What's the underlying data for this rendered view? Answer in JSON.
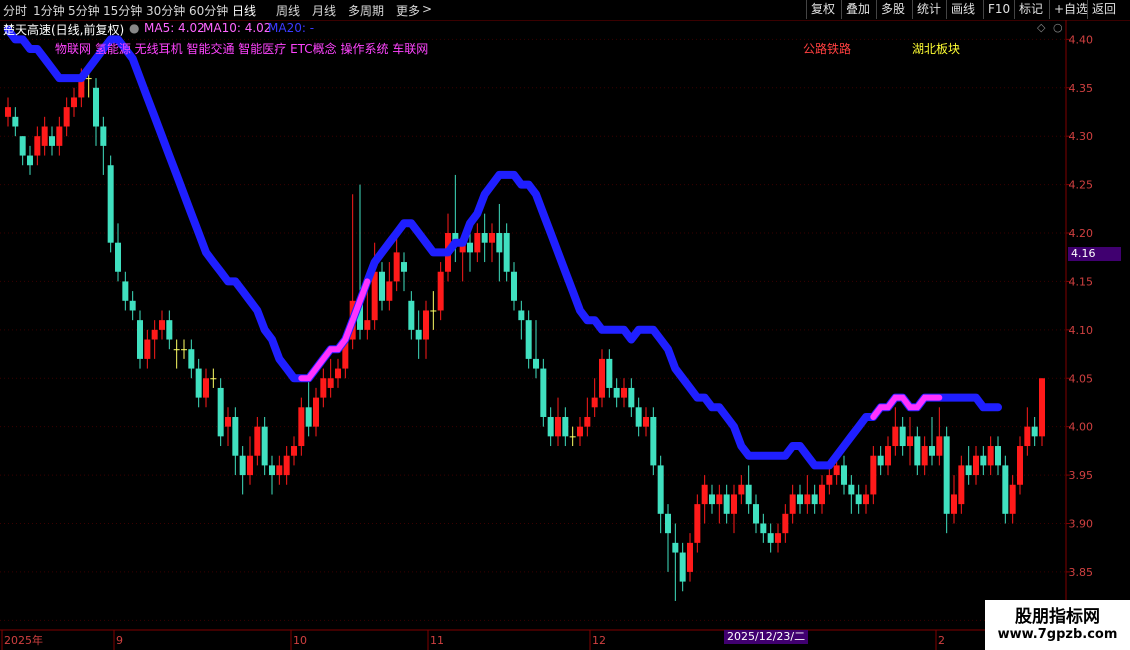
{
  "toolbar": {
    "periods": [
      "分时",
      "1分钟",
      "5分钟",
      "15分钟",
      "30分钟",
      "60分钟",
      "日线",
      "周线",
      "月线",
      "多周期",
      "更多"
    ],
    "active": "日线",
    "more_arrow": ">",
    "buttons": [
      "复权",
      "叠加",
      "多股",
      "统计",
      "画线",
      "F10",
      "标记",
      "+自选",
      "返回"
    ]
  },
  "header": {
    "stock_title": "楚天高速(日线,前复权)",
    "ma5": "MA5: 4.02",
    "ma10": "MA10: 4.02",
    "ma20": "MA20: -",
    "concepts": "物联网 氢能源 无线耳机 智能交通 智能医疗 ETC概念 操作系统 车联网",
    "concept_2": "公路铁路",
    "concept_3": "湖北板块"
  },
  "price_tag": "4.16",
  "date_tag": "2025/12/23/二",
  "watermark": {
    "line1": "股朋指标网",
    "line2": "www.7gpzb.com"
  },
  "colors": {
    "up": "#ff1a1a",
    "down": "#40e0c0",
    "ma": "#1f1fff",
    "ma_highlight": "#ff33ff",
    "axis": "#800000",
    "grid": "#3a0000",
    "text": "#d04040"
  },
  "chart_data": {
    "type": "candlestick",
    "y_ticks": [
      "4.40",
      "4.35",
      "4.30",
      "4.25",
      "4.20",
      "4.15",
      "4.10",
      "4.05",
      "4.00",
      "3.95",
      "3.90",
      "3.85",
      "3.80"
    ],
    "ylim": [
      3.79,
      4.42
    ],
    "x_labels": [
      "2025年",
      "9",
      "10",
      "11",
      "12",
      "2"
    ],
    "candles": [
      [
        4.32,
        4.33,
        4.34,
        4.31
      ],
      [
        4.32,
        4.31,
        4.33,
        4.3
      ],
      [
        4.3,
        4.28,
        4.3,
        4.27
      ],
      [
        4.28,
        4.27,
        4.29,
        4.26
      ],
      [
        4.28,
        4.3,
        4.31,
        4.27
      ],
      [
        4.29,
        4.31,
        4.32,
        4.28
      ],
      [
        4.3,
        4.29,
        4.31,
        4.28
      ],
      [
        4.29,
        4.31,
        4.32,
        4.28
      ],
      [
        4.31,
        4.33,
        4.34,
        4.3
      ],
      [
        4.33,
        4.34,
        4.35,
        4.32
      ],
      [
        4.34,
        4.36,
        4.37,
        4.33
      ],
      [
        4.36,
        4.36,
        4.37,
        4.34
      ],
      [
        4.35,
        4.31,
        4.36,
        4.29
      ],
      [
        4.31,
        4.29,
        4.32,
        4.26
      ],
      [
        4.27,
        4.19,
        4.28,
        4.18
      ],
      [
        4.19,
        4.16,
        4.21,
        4.15
      ],
      [
        4.15,
        4.13,
        4.16,
        4.12
      ],
      [
        4.13,
        4.12,
        4.14,
        4.11
      ],
      [
        4.11,
        4.07,
        4.12,
        4.06
      ],
      [
        4.07,
        4.09,
        4.1,
        4.06
      ],
      [
        4.09,
        4.1,
        4.11,
        4.07
      ],
      [
        4.1,
        4.11,
        4.12,
        4.09
      ],
      [
        4.11,
        4.09,
        4.12,
        4.08
      ],
      [
        4.08,
        4.08,
        4.09,
        4.06
      ],
      [
        4.08,
        4.08,
        4.09,
        4.07
      ],
      [
        4.08,
        4.06,
        4.09,
        4.05
      ],
      [
        4.06,
        4.03,
        4.07,
        4.02
      ],
      [
        4.03,
        4.05,
        4.06,
        4.02
      ],
      [
        4.05,
        4.05,
        4.06,
        4.04
      ],
      [
        4.04,
        3.99,
        4.05,
        3.98
      ],
      [
        4.0,
        4.01,
        4.02,
        3.98
      ],
      [
        4.01,
        3.97,
        4.02,
        3.95
      ],
      [
        3.97,
        3.95,
        3.98,
        3.93
      ],
      [
        3.95,
        3.97,
        3.99,
        3.94
      ],
      [
        3.97,
        4.0,
        4.01,
        3.96
      ],
      [
        4.0,
        3.96,
        4.01,
        3.95
      ],
      [
        3.96,
        3.95,
        3.97,
        3.93
      ],
      [
        3.95,
        3.96,
        3.97,
        3.94
      ],
      [
        3.95,
        3.97,
        3.98,
        3.94
      ],
      [
        3.97,
        3.98,
        3.99,
        3.96
      ],
      [
        3.98,
        4.02,
        4.03,
        3.97
      ],
      [
        4.02,
        4.0,
        4.05,
        3.99
      ],
      [
        4.0,
        4.03,
        4.04,
        3.99
      ],
      [
        4.03,
        4.05,
        4.06,
        4.02
      ],
      [
        4.04,
        4.05,
        4.07,
        4.03
      ],
      [
        4.05,
        4.06,
        4.07,
        4.04
      ],
      [
        4.06,
        4.09,
        4.1,
        4.05
      ],
      [
        4.09,
        4.13,
        4.24,
        4.08
      ],
      [
        4.13,
        4.1,
        4.25,
        4.09
      ],
      [
        4.1,
        4.11,
        4.16,
        4.09
      ],
      [
        4.11,
        4.16,
        4.19,
        4.1
      ],
      [
        4.16,
        4.13,
        4.17,
        4.12
      ],
      [
        4.13,
        4.15,
        4.17,
        4.12
      ],
      [
        4.15,
        4.18,
        4.2,
        4.14
      ],
      [
        4.17,
        4.16,
        4.18,
        4.14
      ],
      [
        4.13,
        4.1,
        4.14,
        4.09
      ],
      [
        4.1,
        4.09,
        4.12,
        4.07
      ],
      [
        4.09,
        4.12,
        4.13,
        4.07
      ],
      [
        4.12,
        4.12,
        4.14,
        4.1
      ],
      [
        4.12,
        4.16,
        4.17,
        4.11
      ],
      [
        4.16,
        4.2,
        4.22,
        4.15
      ],
      [
        4.2,
        4.19,
        4.26,
        4.17
      ],
      [
        4.18,
        4.19,
        4.2,
        4.15
      ],
      [
        4.19,
        4.18,
        4.2,
        4.16
      ],
      [
        4.18,
        4.2,
        4.21,
        4.17
      ],
      [
        4.2,
        4.19,
        4.22,
        4.17
      ],
      [
        4.19,
        4.2,
        4.21,
        4.17
      ],
      [
        4.2,
        4.18,
        4.23,
        4.15
      ],
      [
        4.2,
        4.16,
        4.21,
        4.15
      ],
      [
        4.16,
        4.13,
        4.17,
        4.12
      ],
      [
        4.12,
        4.11,
        4.13,
        4.09
      ],
      [
        4.11,
        4.07,
        4.12,
        4.06
      ],
      [
        4.07,
        4.06,
        4.11,
        4.05
      ],
      [
        4.06,
        4.01,
        4.07,
        4.0
      ],
      [
        4.01,
        3.99,
        4.02,
        3.98
      ],
      [
        3.99,
        4.01,
        4.03,
        3.98
      ],
      [
        4.01,
        3.99,
        4.02,
        3.98
      ],
      [
        3.99,
        3.99,
        4.0,
        3.98
      ],
      [
        3.99,
        4.0,
        4.01,
        3.98
      ],
      [
        4.0,
        4.01,
        4.03,
        3.99
      ],
      [
        4.02,
        4.03,
        4.05,
        4.01
      ],
      [
        4.03,
        4.07,
        4.08,
        4.02
      ],
      [
        4.07,
        4.04,
        4.08,
        4.03
      ],
      [
        4.04,
        4.03,
        4.05,
        4.02
      ],
      [
        4.03,
        4.04,
        4.05,
        4.02
      ],
      [
        4.04,
        4.02,
        4.05,
        4.01
      ],
      [
        4.02,
        4.0,
        4.03,
        3.99
      ],
      [
        4.0,
        4.01,
        4.02,
        3.99
      ],
      [
        4.01,
        3.96,
        4.02,
        3.95
      ],
      [
        3.96,
        3.91,
        3.97,
        3.89
      ],
      [
        3.91,
        3.89,
        3.92,
        3.85
      ],
      [
        3.88,
        3.87,
        3.9,
        3.82
      ],
      [
        3.87,
        3.84,
        3.88,
        3.83
      ],
      [
        3.85,
        3.88,
        3.89,
        3.84
      ],
      [
        3.88,
        3.92,
        3.93,
        3.87
      ],
      [
        3.92,
        3.94,
        3.95,
        3.9
      ],
      [
        3.93,
        3.92,
        3.94,
        3.91
      ],
      [
        3.92,
        3.93,
        3.94,
        3.9
      ],
      [
        3.93,
        3.91,
        3.94,
        3.9
      ],
      [
        3.91,
        3.93,
        3.94,
        3.89
      ],
      [
        3.93,
        3.94,
        3.95,
        3.92
      ],
      [
        3.94,
        3.92,
        3.96,
        3.91
      ],
      [
        3.92,
        3.9,
        3.93,
        3.89
      ],
      [
        3.9,
        3.89,
        3.91,
        3.88
      ],
      [
        3.89,
        3.88,
        3.9,
        3.87
      ],
      [
        3.88,
        3.89,
        3.9,
        3.87
      ],
      [
        3.89,
        3.91,
        3.92,
        3.88
      ],
      [
        3.91,
        3.93,
        3.94,
        3.9
      ],
      [
        3.93,
        3.92,
        3.94,
        3.91
      ],
      [
        3.92,
        3.93,
        3.95,
        3.91
      ],
      [
        3.93,
        3.92,
        3.94,
        3.91
      ],
      [
        3.92,
        3.94,
        3.95,
        3.91
      ],
      [
        3.94,
        3.95,
        3.96,
        3.93
      ],
      [
        3.95,
        3.96,
        3.97,
        3.94
      ],
      [
        3.96,
        3.94,
        3.97,
        3.93
      ],
      [
        3.94,
        3.93,
        3.95,
        3.91
      ],
      [
        3.93,
        3.92,
        3.94,
        3.91
      ],
      [
        3.92,
        3.93,
        3.94,
        3.91
      ],
      [
        3.93,
        3.97,
        3.98,
        3.92
      ],
      [
        3.97,
        3.96,
        3.98,
        3.95
      ],
      [
        3.96,
        3.98,
        3.99,
        3.95
      ],
      [
        3.98,
        4.0,
        4.02,
        3.97
      ],
      [
        4.0,
        3.98,
        4.01,
        3.97
      ],
      [
        3.98,
        3.99,
        4.01,
        3.96
      ],
      [
        3.99,
        3.96,
        4.0,
        3.95
      ],
      [
        3.96,
        3.98,
        3.99,
        3.95
      ],
      [
        3.98,
        3.97,
        4.01,
        3.96
      ],
      [
        3.97,
        3.99,
        4.02,
        3.96
      ],
      [
        3.99,
        3.91,
        4.0,
        3.89
      ],
      [
        3.91,
        3.93,
        3.95,
        3.9
      ],
      [
        3.92,
        3.96,
        3.97,
        3.91
      ],
      [
        3.96,
        3.95,
        3.98,
        3.94
      ],
      [
        3.95,
        3.97,
        3.98,
        3.94
      ],
      [
        3.97,
        3.96,
        3.98,
        3.95
      ],
      [
        3.96,
        3.98,
        3.99,
        3.95
      ],
      [
        3.98,
        3.96,
        3.99,
        3.95
      ],
      [
        3.96,
        3.91,
        3.97,
        3.9
      ],
      [
        3.91,
        3.94,
        3.95,
        3.9
      ],
      [
        3.94,
        3.98,
        3.99,
        3.93
      ],
      [
        3.98,
        4.0,
        4.02,
        3.97
      ],
      [
        4.0,
        3.99,
        4.01,
        3.98
      ],
      [
        3.99,
        4.05,
        4.05,
        3.98
      ]
    ],
    "ma20": [
      4.41,
      4.4,
      4.4,
      4.39,
      4.39,
      4.38,
      4.37,
      4.36,
      4.36,
      4.36,
      4.36,
      4.37,
      4.38,
      4.39,
      4.4,
      4.4,
      4.39,
      4.38,
      4.36,
      4.34,
      4.32,
      4.3,
      4.28,
      4.26,
      4.24,
      4.22,
      4.2,
      4.18,
      4.17,
      4.16,
      4.15,
      4.15,
      4.14,
      4.13,
      4.12,
      4.1,
      4.09,
      4.07,
      4.06,
      4.05,
      4.05,
      4.05,
      4.06,
      4.07,
      4.08,
      4.08,
      4.09,
      4.11,
      4.13,
      4.15,
      4.17,
      4.18,
      4.19,
      4.2,
      4.21,
      4.21,
      4.2,
      4.19,
      4.18,
      4.18,
      4.18,
      4.19,
      4.19,
      4.21,
      4.22,
      4.24,
      4.25,
      4.26,
      4.26,
      4.26,
      4.25,
      4.25,
      4.24,
      4.22,
      4.2,
      4.18,
      4.16,
      4.14,
      4.12,
      4.11,
      4.11,
      4.1,
      4.1,
      4.1,
      4.1,
      4.09,
      4.1,
      4.1,
      4.1,
      4.09,
      4.08,
      4.06,
      4.05,
      4.04,
      4.03,
      4.03,
      4.02,
      4.02,
      4.01,
      4.0,
      3.98,
      3.97,
      3.97,
      3.97,
      3.97,
      3.97,
      3.97,
      3.98,
      3.98,
      3.97,
      3.96,
      3.96,
      3.96,
      3.97,
      3.98,
      3.99,
      4.0,
      4.01,
      4.01,
      4.02,
      4.02,
      4.03,
      4.03,
      4.02,
      4.02,
      4.03,
      4.03,
      4.03,
      4.03,
      4.03,
      4.03,
      4.03,
      4.03,
      4.02,
      4.02,
      4.02
    ],
    "ma20_highlight_ranges": [
      [
        40,
        49
      ],
      [
        118,
        127
      ]
    ]
  }
}
